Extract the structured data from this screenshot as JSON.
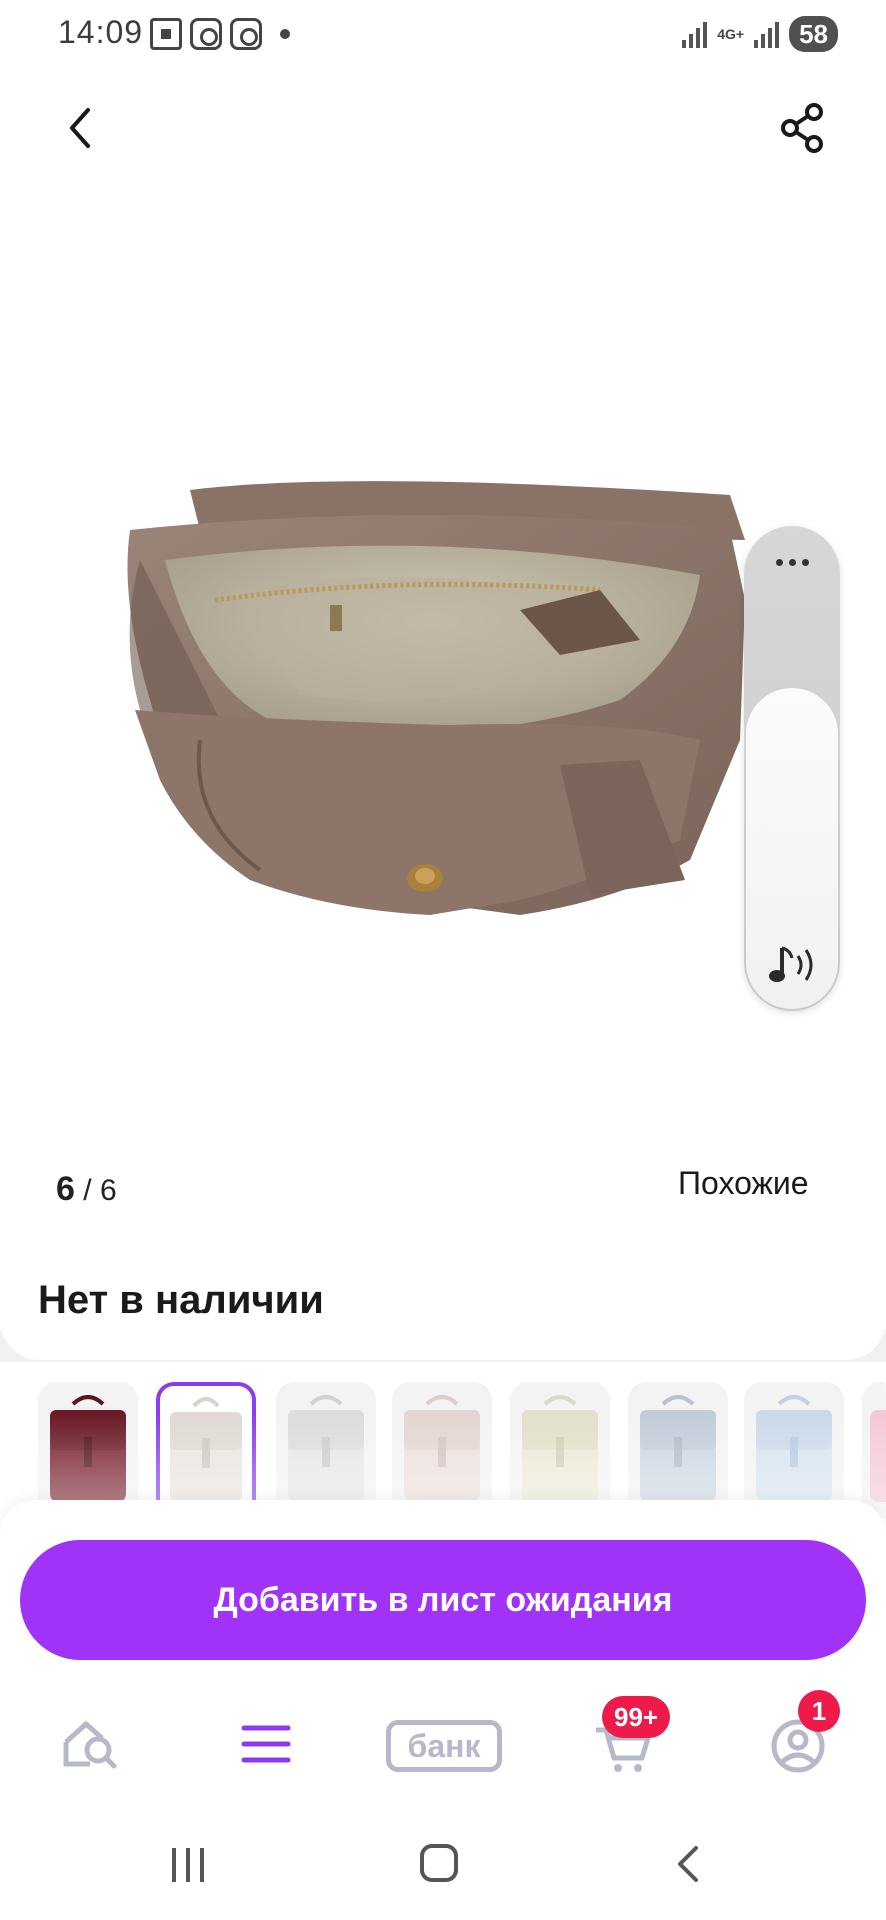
{
  "status_bar": {
    "time": "14:09",
    "network": "4G+",
    "battery": "58"
  },
  "header": {
    "back_icon": "chevron-left-icon",
    "share_icon": "share-icon"
  },
  "gallery": {
    "current": "6",
    "separator": " / ",
    "total": "6",
    "similar_label": "Похожие"
  },
  "side_panel": {
    "more_icon": "more-horizontal-icon",
    "sound_icon": "music-note-icon"
  },
  "product": {
    "availability": "Нет в наличии"
  },
  "variants": {
    "selected_index": 1,
    "items": [
      {
        "color": "#7a2230"
      },
      {
        "color": "#e9e4df"
      },
      {
        "color": "#e6e6e6"
      },
      {
        "color": "#ecdfdc"
      },
      {
        "color": "#ebead6"
      },
      {
        "color": "#cdd6e2"
      },
      {
        "color": "#d6e3f0"
      },
      {
        "color": "#f4c8d4"
      }
    ]
  },
  "cta": {
    "label": "Добавить в лист ожидания",
    "color": "#a033f7"
  },
  "bottom_nav": {
    "items": [
      {
        "icon": "home-search-icon"
      },
      {
        "icon": "catalog-menu-icon"
      },
      {
        "icon": "bank-icon",
        "label": "банк"
      },
      {
        "icon": "cart-icon",
        "badge": "99+"
      },
      {
        "icon": "profile-icon",
        "badge": "1"
      }
    ],
    "accent": "#8b3cf0"
  }
}
